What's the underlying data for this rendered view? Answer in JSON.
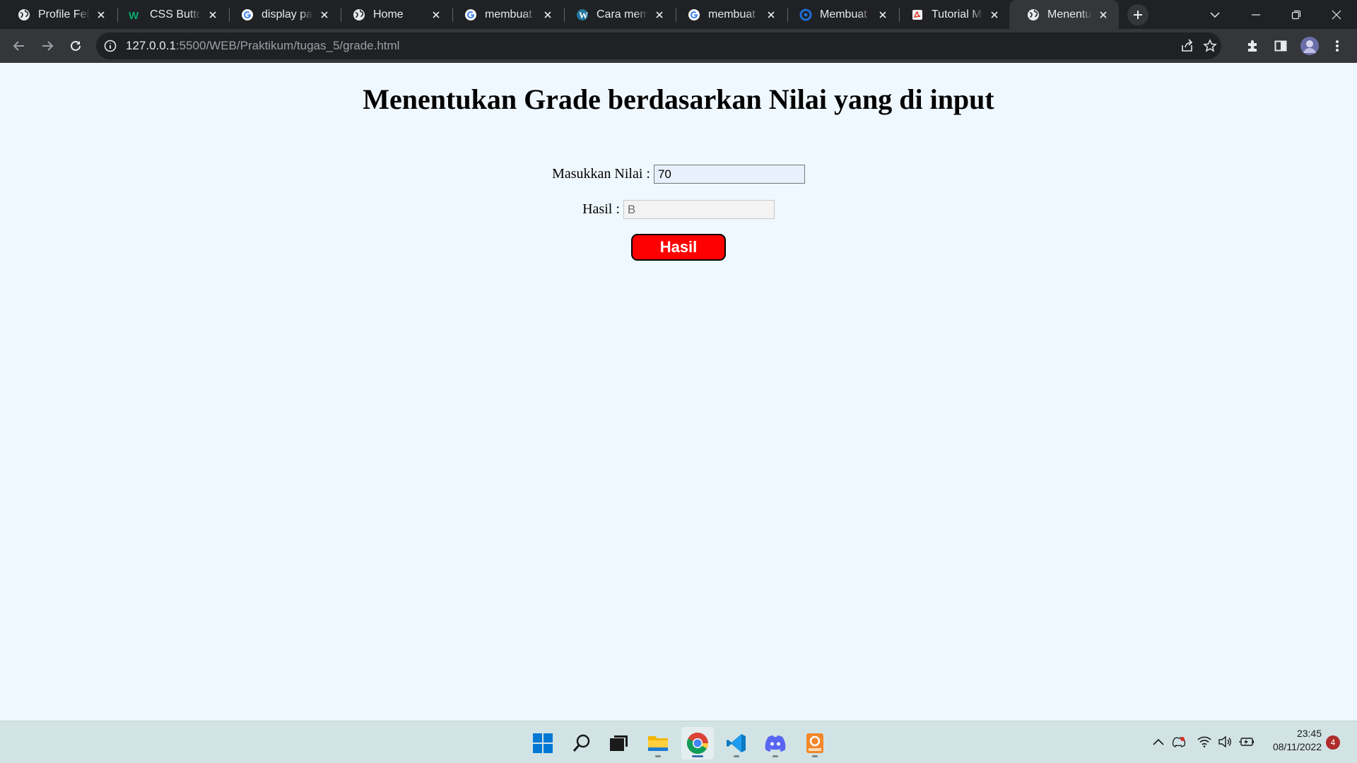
{
  "browser": {
    "tabs": [
      {
        "title": "Profile Febr",
        "icon": "globe-icon"
      },
      {
        "title": "CSS Button",
        "icon": "w3-icon"
      },
      {
        "title": "display pad",
        "icon": "google-icon"
      },
      {
        "title": "Home",
        "icon": "globe-icon"
      },
      {
        "title": "membuat t",
        "icon": "google-icon"
      },
      {
        "title": "Cara memb",
        "icon": "wordpress-icon"
      },
      {
        "title": "membuat t",
        "icon": "google-icon"
      },
      {
        "title": "Membuat E",
        "icon": "circle-logo-icon"
      },
      {
        "title": "Tutorial Me",
        "icon": "pdf-icon"
      },
      {
        "title": "Menentuka",
        "icon": "globe-icon",
        "active": true
      }
    ],
    "address": {
      "host": "127.0.0.1",
      "path": ":5500/WEB/Praktikum/tugas_5/grade.html"
    }
  },
  "page": {
    "heading": "Menentukan Grade berdasarkan Nilai yang di input",
    "nilai_label": "Masukkan Nilai :",
    "nilai_value": "70",
    "hasil_label": "Hasil :",
    "hasil_value": "B",
    "button_label": "Hasil"
  },
  "taskbar": {
    "apps": [
      "start-icon",
      "search-icon",
      "task-view-icon",
      "file-explorer-icon",
      "chrome-icon",
      "vscode-icon",
      "discord-icon",
      "pdf-app-icon"
    ],
    "time": "23:45",
    "date": "08/11/2022",
    "notifications": "4"
  },
  "colors": {
    "page_bg": "#f0f8ff",
    "button_bg": "#ff0000",
    "tabstrip": "#202124",
    "toolbar": "#35363a"
  }
}
